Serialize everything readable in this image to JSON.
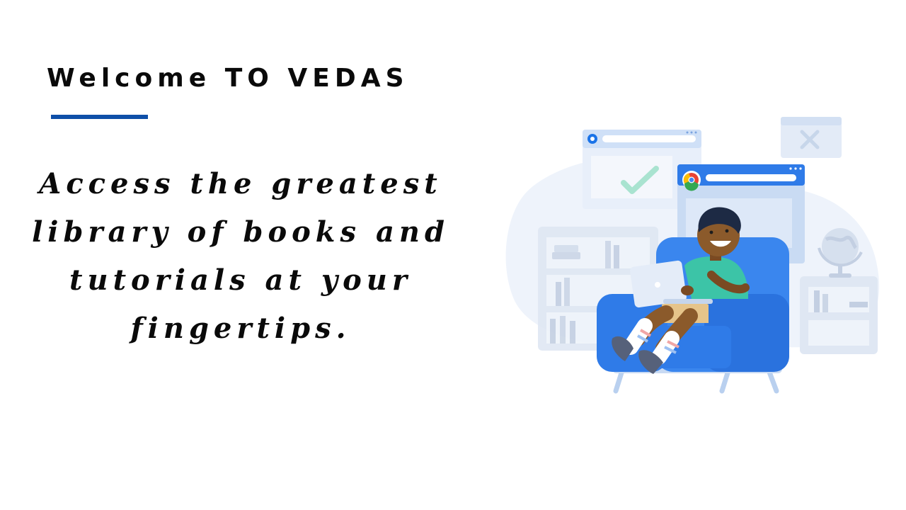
{
  "title": "Welcome TO VEDAS",
  "tagline": "Access the greatest library of books and tutorials at your fingertips.",
  "colors": {
    "accent": "#0e4fa8",
    "text": "#0a0a0a",
    "chair": "#2f7be8",
    "light_blue": "#dbe7f7"
  },
  "illustration": {
    "elements": [
      "browser-window-check-icon",
      "browser-window-chrome-icon",
      "close-window-icon",
      "bookshelf",
      "globe-icon",
      "armchair",
      "laptop-icon",
      "person-reading"
    ]
  }
}
